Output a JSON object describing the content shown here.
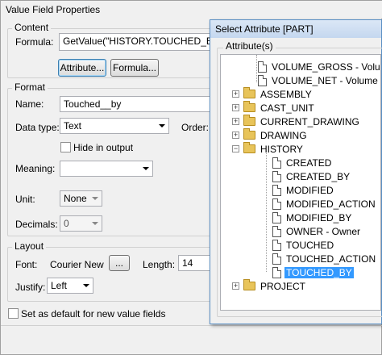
{
  "main_dialog": {
    "title": "Value Field Properties",
    "content_group": {
      "label": "Content",
      "formula_label": "Formula:",
      "formula_value": "GetValue(\"HISTORY.TOUCHED_BY\")",
      "attribute_button": "Attribute...",
      "formula_button": "Formula..."
    },
    "format_group": {
      "label": "Format",
      "name_label": "Name:",
      "name_value": "Touched__by",
      "datatype_label": "Data type:",
      "datatype_value": "Text",
      "order_label": "Order:",
      "hide_label": "Hide in output",
      "meaning_label": "Meaning:",
      "meaning_value": "",
      "unit_label": "Unit:",
      "unit_value": "None",
      "decimals_label": "Decimals:",
      "decimals_value": "0"
    },
    "layout_group": {
      "label": "Layout",
      "font_label": "Font:",
      "font_value": "Courier New",
      "font_button": "...",
      "length_label": "Length:",
      "length_value": "14",
      "justify_label": "Justify:",
      "justify_value": "Left"
    },
    "default_checkbox_label": "Set as default for new value fields"
  },
  "attr_dialog": {
    "title": "Select Attribute [PART]",
    "group_label": "Attribute(s)",
    "tree": [
      {
        "text": "VOLUME_GROSS  -  Volume",
        "type": "leaf",
        "level": 1
      },
      {
        "text": "VOLUME_NET  -  Volume wi",
        "type": "leaf",
        "level": 1
      },
      {
        "text": "ASSEMBLY",
        "type": "folder",
        "level": 0,
        "expander": "+"
      },
      {
        "text": "CAST_UNIT",
        "type": "folder",
        "level": 0,
        "expander": "+"
      },
      {
        "text": "CURRENT_DRAWING",
        "type": "folder",
        "level": 0,
        "expander": "+"
      },
      {
        "text": "DRAWING",
        "type": "folder",
        "level": 0,
        "expander": "+"
      },
      {
        "text": "HISTORY",
        "type": "folder",
        "level": 0,
        "expander": "−"
      },
      {
        "text": "CREATED",
        "type": "leaf",
        "level": 1
      },
      {
        "text": "CREATED_BY",
        "type": "leaf",
        "level": 1
      },
      {
        "text": "MODIFIED",
        "type": "leaf",
        "level": 1
      },
      {
        "text": "MODIFIED_ACTION",
        "type": "leaf",
        "level": 1
      },
      {
        "text": "MODIFIED_BY",
        "type": "leaf",
        "level": 1
      },
      {
        "text": "OWNER  -  Owner",
        "type": "leaf",
        "level": 1
      },
      {
        "text": "TOUCHED",
        "type": "leaf",
        "level": 1
      },
      {
        "text": "TOUCHED_ACTION",
        "type": "leaf",
        "level": 1
      },
      {
        "text": "TOUCHED_BY",
        "type": "leaf",
        "level": 1,
        "selected": true
      },
      {
        "text": "PROJECT",
        "type": "folder",
        "level": 0,
        "expander": "+"
      }
    ]
  },
  "colors": {
    "selection": "#3399ff",
    "folder": "#e8c45a",
    "dialog_bg": "#f0f0f0"
  }
}
